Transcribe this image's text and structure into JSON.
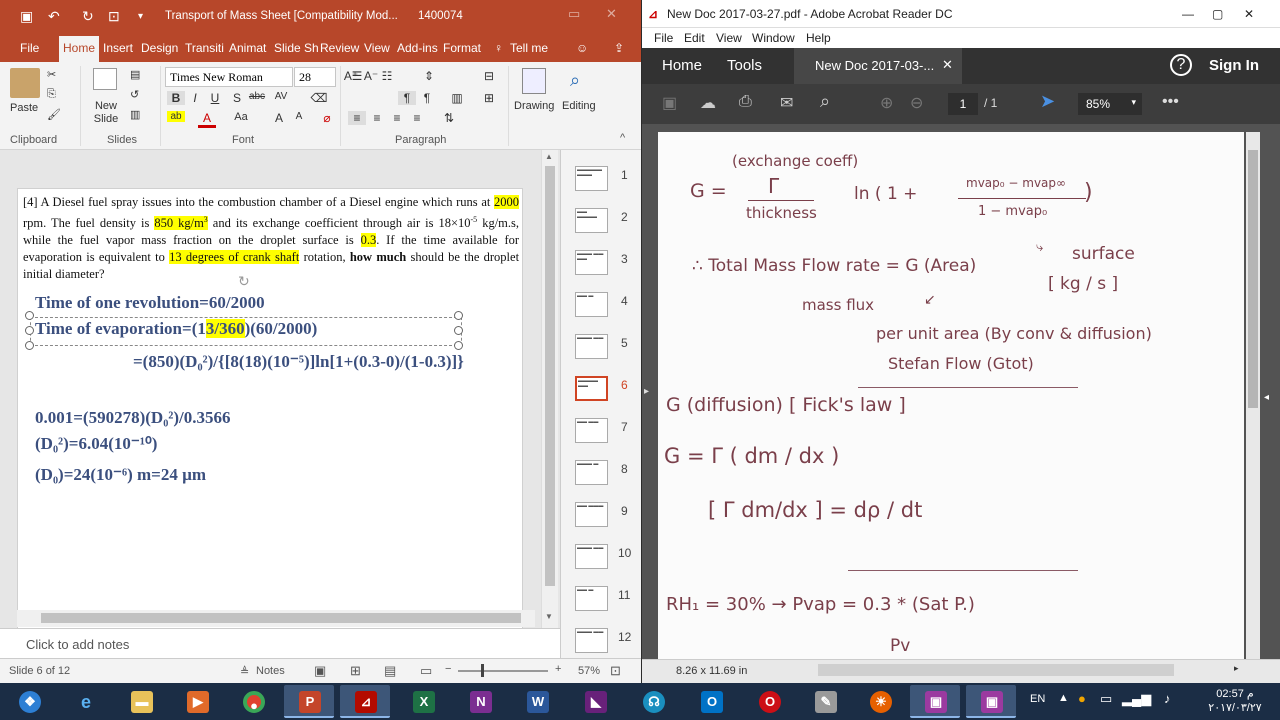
{
  "ppt": {
    "title": "Transport of Mass Sheet [Compatibility Mod...",
    "title_suffix": "1400074",
    "tabs": [
      "File",
      "Home",
      "Insert",
      "Design",
      "Transiti",
      "Animat",
      "Slide Sh",
      "Review",
      "View",
      "Add-ins",
      "Format",
      "Tell me"
    ],
    "ribbon": {
      "paste": "Paste",
      "new_slide": "New Slide",
      "font_name": "Times New Roman",
      "font_size": "28",
      "drawing": "Drawing",
      "editing": "Editing",
      "groups": [
        "Clipboard",
        "Slides",
        "Font",
        "Paragraph"
      ]
    },
    "slide": {
      "q_num": "[4]",
      "q1": "A Diesel fuel spray issues into the combustion chamber of a Diesel engine which runs at",
      "rpm": "2000",
      "q2": "rpm. The fuel density is",
      "density": "850 kg/m",
      "density_exp": "3",
      "q3": "and its exchange coefficient through air is 18×10",
      "coef_exp": "-5",
      "q4": "kg/m.s, while the fuel vapor mass fraction on the droplet surface is",
      "frac": "0.3",
      "q5": ". If the time available for evaporation is equivalent to",
      "deg": "13 degrees of crank shaft",
      "q6": "rotation,",
      "q7": "how much",
      "q8": "should be the droplet initial diameter?",
      "eq1": "Time of one revolution=60/2000",
      "eq2a": "Time of evaporation=(1",
      "eq2b": "3/360",
      "eq2c": ")(60/2000)",
      "eq3": "=(850)(D₀²)/{[8(18)(10⁻⁵)]ln[1+(0.3-0)/(1-0.3)]}",
      "eq4": "0.001=(590278)(D₀²)/0.3566",
      "eq5": "(D₀²)=6.04(10⁻¹⁰)",
      "eq6": "(D₀)=24(10⁻⁶) m=24 µm"
    },
    "notes_placeholder": "Click to add notes",
    "status": {
      "slide": "Slide 6 of 12",
      "notes": "Notes",
      "zoom": "57%"
    },
    "thumbnails": [
      "1",
      "2",
      "3",
      "4",
      "5",
      "6",
      "7",
      "8",
      "9",
      "10",
      "11",
      "12"
    ],
    "selected_thumb": 6
  },
  "acrobat": {
    "title": "New Doc 2017-03-27.pdf - Adobe Acrobat Reader DC",
    "menu": [
      "File",
      "Edit",
      "View",
      "Window",
      "Help"
    ],
    "tabs": {
      "home": "Home",
      "tools": "Tools",
      "doc": "New Doc 2017-03-...",
      "signin": "Sign In"
    },
    "page": "1",
    "pages": "/ 1",
    "zoom": "85%",
    "page_size": "8.26 x 11.69 in",
    "notes": {
      "l1": "(exchange coeff)",
      "l2": "G =",
      "l3": "Γ",
      "l4": "thickness",
      "l5": "ln ( 1 +",
      "l6": "mvap₀ − mvap∞",
      "l7": "1 − mvap₀",
      "l8": "surface",
      "l9": "∴ Total Mass Flow rate = G (Area)",
      "l10": "[ kg / s ]",
      "l11": "mass flux",
      "l12": "per unit area (By conv & diffusion)",
      "l13": "Stefan Flow (Gtot)",
      "l14": "G (diffusion) [ Fick's law ]",
      "l15": "G = Γ ( dm / dx )",
      "l16": "[ Γ dm/dx ] = dρ / dt",
      "l17": "RH₁ = 30%  →  Pvap = 0.3 * (Sat P.)",
      "l18": "Pv"
    }
  },
  "taskbar": {
    "time": "02:57 م",
    "date": "٢٠١٧/٠٣/٢٧",
    "lang": "EN"
  }
}
